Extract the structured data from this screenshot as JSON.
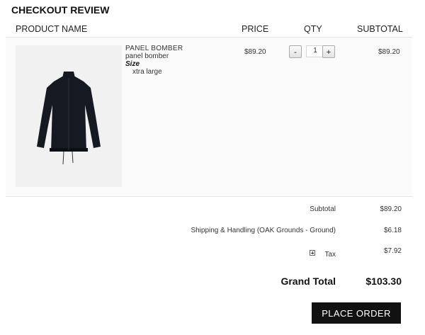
{
  "page": {
    "title": "CHECKOUT REVIEW"
  },
  "table": {
    "headers": {
      "product": "PRODUCT NAME",
      "price": "PRICE",
      "qty": "QTY",
      "subtotal": "SUBTOTAL"
    }
  },
  "item": {
    "name": "PANEL BOMBER",
    "sub_name": "panel bomber",
    "option_label": "Size",
    "option_value": "xtra large",
    "price": "$89.20",
    "qty": "1",
    "minus_label": "-",
    "plus_label": "+",
    "subtotal": "$89.20"
  },
  "totals": {
    "subtotal_label": "Subtotal",
    "subtotal_value": "$89.20",
    "shipping_label": "Shipping & Handling (OAK Grounds - Ground)",
    "shipping_value": "$6.18",
    "tax_label": "Tax",
    "tax_value": "$7.92",
    "grand_label": "Grand Total",
    "grand_value": "$103.30"
  },
  "actions": {
    "place_order": "PLACE ORDER"
  },
  "colors": {
    "button_bg": "#111111",
    "row_bg": "#fafafa",
    "product_image_bg": "#f1f1f1",
    "jacket": "#151a22"
  }
}
